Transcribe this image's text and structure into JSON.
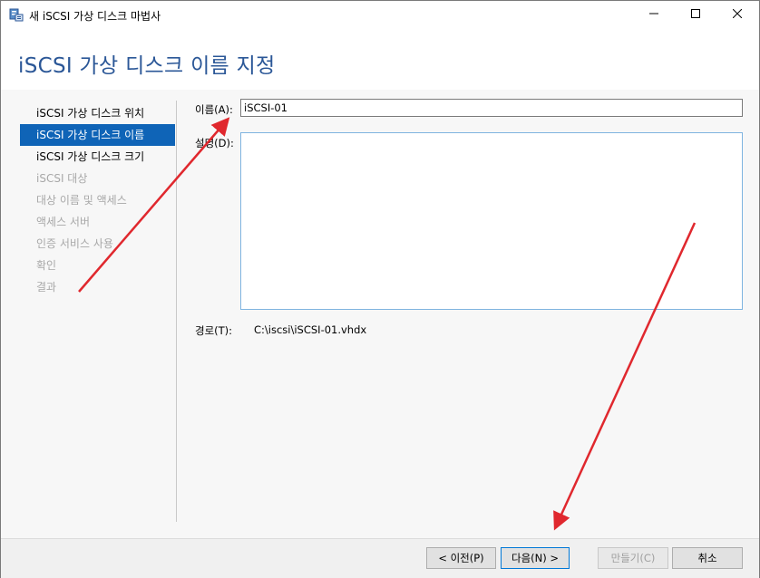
{
  "window": {
    "title": "새 iSCSI 가상 디스크 마법사",
    "app_icon": "iscsi-wizard-icon",
    "controls": {
      "minimize_icon": "minimize-icon",
      "maximize_icon": "maximize-icon",
      "close_icon": "close-icon"
    }
  },
  "header": {
    "title": "iSCSI 가상 디스크 이름 지정"
  },
  "nav": {
    "items": [
      {
        "label": "iSCSI 가상 디스크 위치",
        "state": "normal"
      },
      {
        "label": "iSCSI 가상 디스크 이름",
        "state": "selected"
      },
      {
        "label": "iSCSI 가상 디스크 크기",
        "state": "normal"
      },
      {
        "label": "iSCSI 대상",
        "state": "disabled"
      },
      {
        "label": "대상 이름 및 액세스",
        "state": "disabled"
      },
      {
        "label": "액세스 서버",
        "state": "disabled"
      },
      {
        "label": "인증 서비스 사용",
        "state": "disabled"
      },
      {
        "label": "확인",
        "state": "disabled"
      },
      {
        "label": "결과",
        "state": "disabled"
      }
    ]
  },
  "form": {
    "name_label": "이름(A):",
    "name_value": "iSCSI-01",
    "description_label": "설명(D):",
    "description_value": "",
    "path_label": "경로(T):",
    "path_value": "C:\\iscsi\\iSCSI-01.vhdx"
  },
  "footer": {
    "prev_label": "< 이전(P)",
    "next_label": "다음(N) >",
    "create_label": "만들기(C)",
    "cancel_label": "취소"
  },
  "colors": {
    "accent": "#0f64b7",
    "title": "#2b5797",
    "annotation_arrow": "#e0282e"
  }
}
